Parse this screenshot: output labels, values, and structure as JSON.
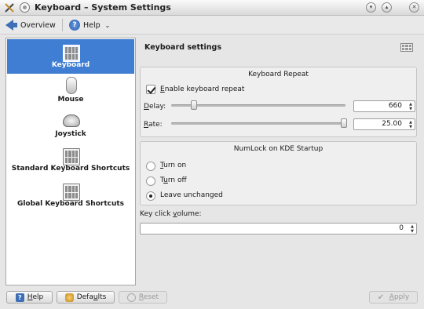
{
  "window": {
    "title": "Keyboard – System Settings",
    "controls": {
      "minimize": "▾",
      "maximize": "▴",
      "close": "✕"
    }
  },
  "toolbar": {
    "overview_label": "Overview",
    "help_label": "Help",
    "help_glyph": "?",
    "help_chevron": "⌄"
  },
  "sidebar": {
    "items": [
      {
        "label": "Keyboard",
        "icon": "keyboard-icon",
        "selected": true
      },
      {
        "label": "Mouse",
        "icon": "mouse-icon",
        "selected": false
      },
      {
        "label": "Joystick",
        "icon": "joystick-icon",
        "selected": false
      },
      {
        "label": "Standard Keyboard Shortcuts",
        "icon": "keyboard-shortcuts-icon",
        "selected": false
      },
      {
        "label": "Global Keyboard Shortcuts",
        "icon": "global-shortcuts-icon",
        "selected": false
      }
    ]
  },
  "main": {
    "header": "Keyboard settings",
    "repeat_group": {
      "title": "Keyboard Repeat",
      "enable_label": "Enable keyboard repeat",
      "enable_checked": true,
      "delay_label": "Delay:",
      "delay_value": "660",
      "delay_slider_fraction": 0.14,
      "rate_label": "Rate:",
      "rate_value": "25.00",
      "rate_slider_fraction": 1.0
    },
    "numlock_group": {
      "title": "NumLock on KDE Startup",
      "options": [
        {
          "label": "Turn on",
          "checked": false
        },
        {
          "label": "Turn off",
          "checked": false
        },
        {
          "label": "Leave unchanged",
          "checked": true
        }
      ]
    },
    "click_volume": {
      "label": "Key click volume:",
      "value": "0"
    }
  },
  "buttons": {
    "help": "Help",
    "defaults": "Defaults",
    "reset": "Reset",
    "apply": "Apply",
    "reset_enabled": false,
    "apply_enabled": false
  },
  "colors": {
    "selection": "#3f7ed2",
    "accent": "#3c6fb6"
  }
}
